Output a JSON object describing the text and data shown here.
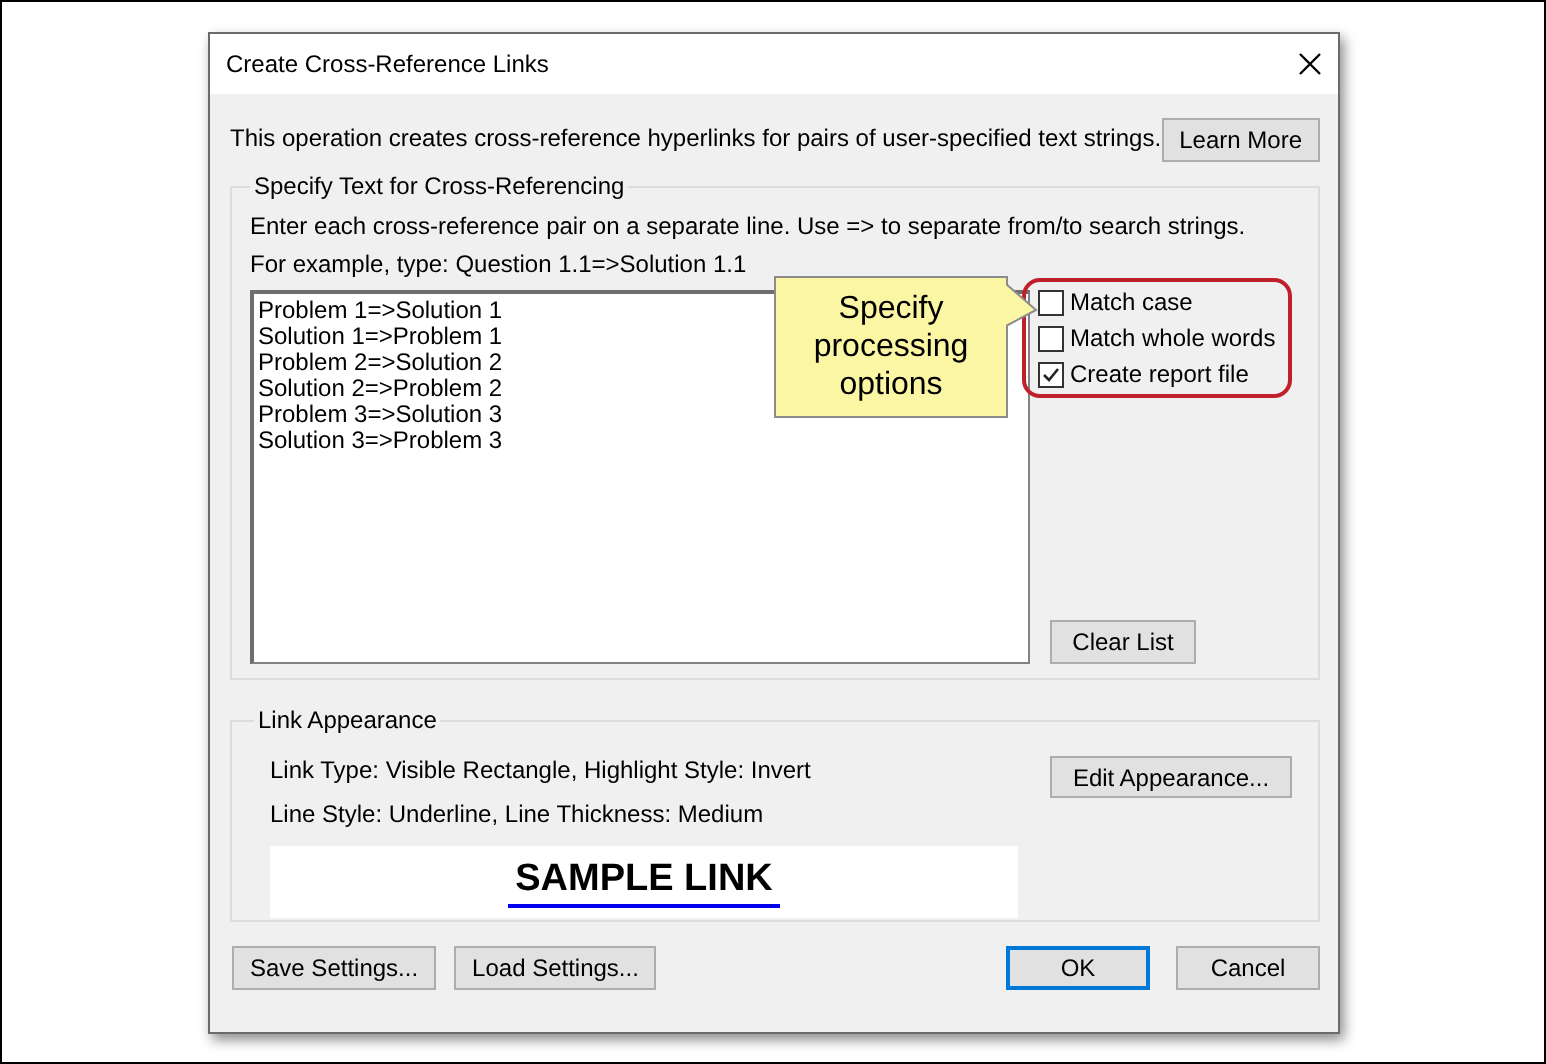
{
  "window": {
    "title": "Create Cross-Reference Links"
  },
  "description": "This operation creates cross-reference hyperlinks for pairs of user-specified text strings.",
  "learn_more_button": "Learn More",
  "text_group": {
    "label": "Specify Text for Cross-Referencing",
    "instructions": [
      "Enter each cross-reference pair on a separate line. Use => to separate from/to search strings.",
      "For example, type: Question 1.1=>Solution 1.1"
    ],
    "pairs": [
      "Problem 1=>Solution 1",
      "Solution 1=>Problem 1",
      "Problem 2=>Solution 2",
      "Solution 2=>Problem 2",
      "Problem 3=>Solution 3",
      "Solution 3=>Problem 3"
    ],
    "options": [
      {
        "label": "Match case",
        "checked": false
      },
      {
        "label": "Match whole words",
        "checked": false
      },
      {
        "label": "Create report file",
        "checked": true
      }
    ],
    "clear_button": "Clear List"
  },
  "callout": {
    "text": "Specify processing options"
  },
  "appearance_group": {
    "label": "Link Appearance",
    "lines": [
      "Link Type: Visible Rectangle, Highlight Style: Invert",
      "Line Style: Underline, Line Thickness: Medium"
    ],
    "edit_button": "Edit Appearance...",
    "sample_link": "SAMPLE LINK"
  },
  "left_buttons": [
    {
      "label": "Save Settings..."
    },
    {
      "label": "Load Settings..."
    }
  ],
  "right_buttons": [
    {
      "label": "OK",
      "kind": "default"
    },
    {
      "label": "Cancel",
      "kind": "plain"
    }
  ]
}
